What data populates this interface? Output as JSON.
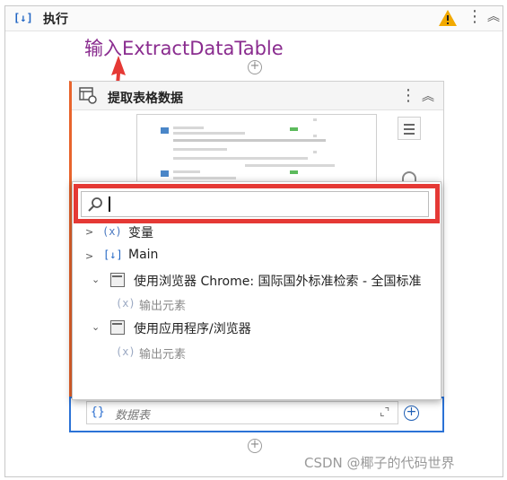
{
  "annotation": "输入ExtractDataTable",
  "execute": {
    "title": "执行",
    "warning_icon": "warning-triangle-icon",
    "warning_color": "#f2a900"
  },
  "activity": {
    "title": "提取表格数据",
    "accent_color": "#e8642c"
  },
  "datatable_field": {
    "brace": "{}",
    "placeholder": "数据表",
    "border_color": "#2b72d6"
  },
  "search": {
    "value": "",
    "highlight_color": "#e53935"
  },
  "tree": {
    "variables": {
      "label": "变量",
      "icon_text": "(x)"
    },
    "main": {
      "label": "Main",
      "icon_text": "[↓]"
    },
    "browser_scope": {
      "label": "使用浏览器 Chrome: 国际国外标准检索 - 全国标准",
      "child": "输出元素"
    },
    "app_scope": {
      "label": "使用应用程序/浏览器",
      "child": "输出元素"
    }
  },
  "watermark": "CSDN @椰子的代码世界"
}
